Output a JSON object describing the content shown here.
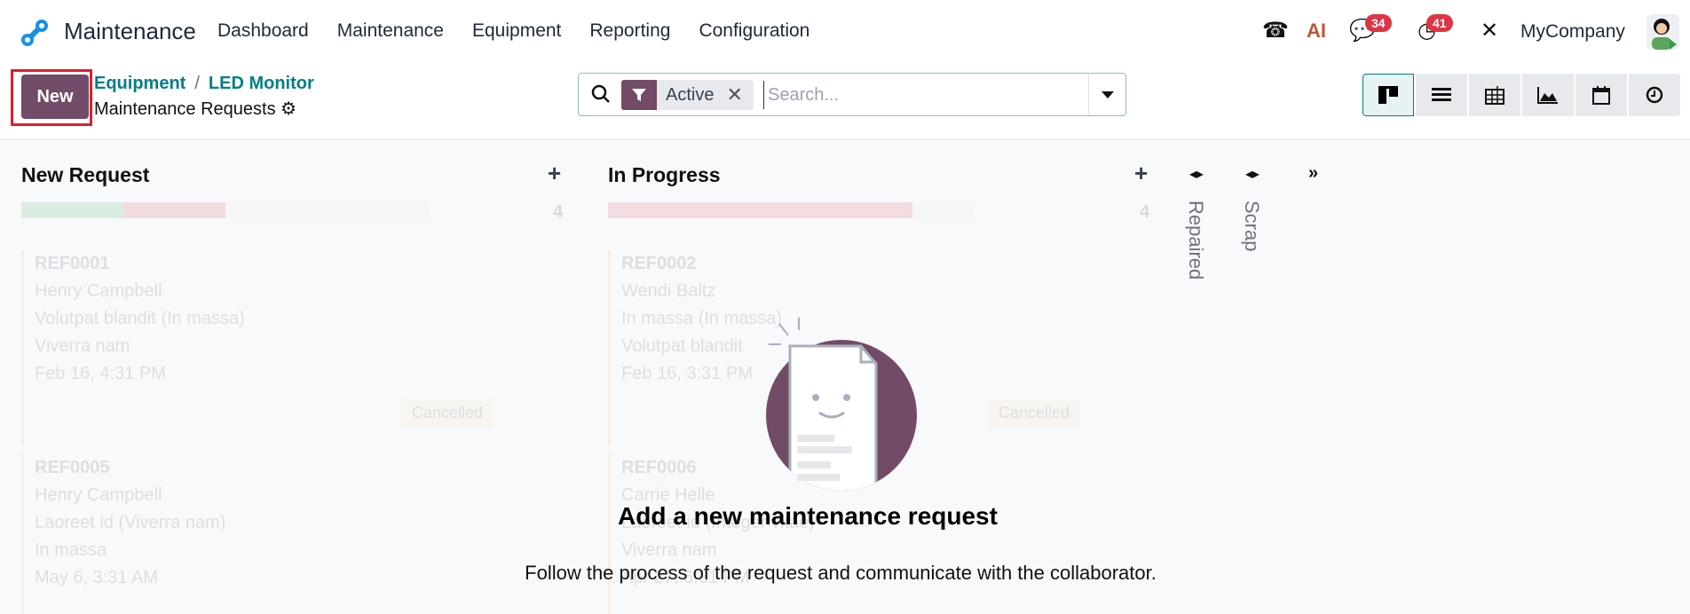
{
  "navbar": {
    "app_name": "Maintenance",
    "menu": [
      "Dashboard",
      "Maintenance",
      "Equipment",
      "Reporting",
      "Configuration"
    ],
    "messages_count": "34",
    "activities_count": "41",
    "ai_label": "AI",
    "company": "MyCompany"
  },
  "control_panel": {
    "new_label": "New",
    "breadcrumb": [
      "Equipment",
      "LED Monitor"
    ],
    "subtitle": "Maintenance Requests",
    "facet_label": "Active",
    "search_placeholder": "Search..."
  },
  "view_switcher": [
    "kanban",
    "list",
    "pivot",
    "graph",
    "calendar",
    "activity"
  ],
  "columns": [
    {
      "title": "New Request",
      "count": "4",
      "cards": [
        {
          "ref": "REF0001",
          "user": "Henry Campbell",
          "equipment": "Volutpat blandit (In massa)",
          "category": "Viverra nam",
          "date": "Feb 16, 4:31 PM",
          "status": "Cancelled"
        },
        {
          "ref": "REF0005",
          "user": "Henry Campbell",
          "equipment": "Laoreet id (Viverra nam)",
          "category": "In massa",
          "date": "May 6, 3:31 AM"
        }
      ]
    },
    {
      "title": "In Progress",
      "count": "4",
      "cards": [
        {
          "ref": "REF0002",
          "user": "Wendi Baltz",
          "equipment": "In massa (In massa)",
          "category": "Volutpat blandit",
          "date": "Feb 16, 3:31 PM",
          "status": "Cancelled"
        },
        {
          "ref": "REF0006",
          "user": "Carrie Helle",
          "equipment": "Laoreet id (Integer vitae)",
          "category": "Viverra nam",
          "date": "Apr 27, 6:31 PM"
        }
      ]
    }
  ],
  "folded_columns": [
    "Repaired",
    "Scrap"
  ],
  "helper": {
    "title": "Add a new maintenance request",
    "subtitle": "Follow the process of the request and communicate with the collaborator."
  },
  "colors": {
    "brand": "#714b67",
    "link": "#017e84",
    "badge": "#dc3545"
  }
}
